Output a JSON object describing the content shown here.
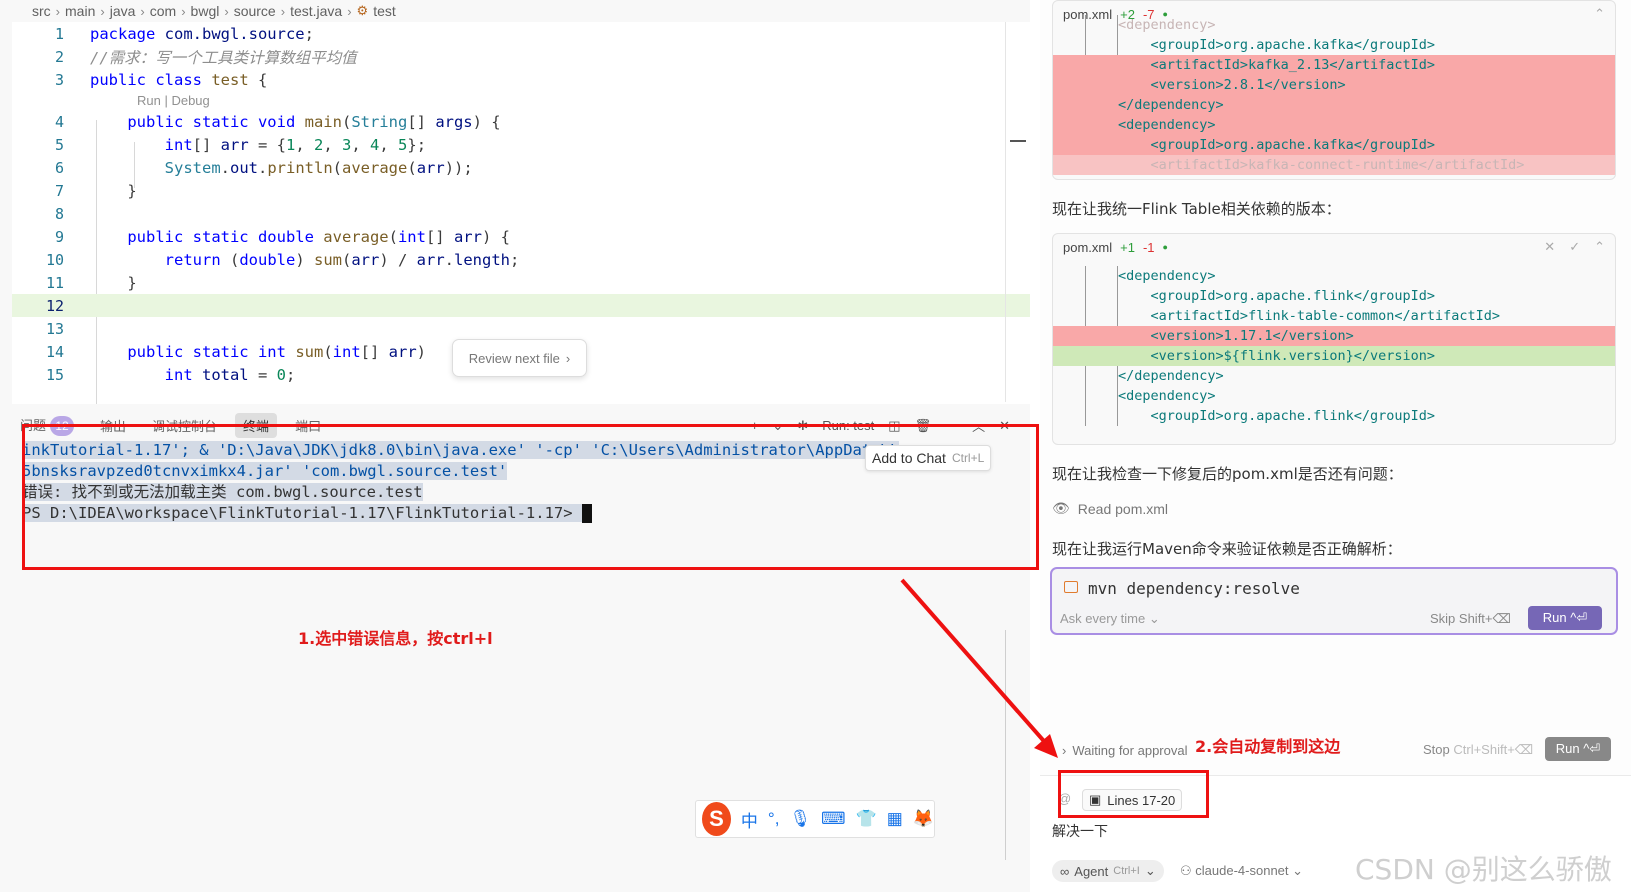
{
  "breadcrumb": {
    "items": [
      "src",
      "main",
      "java",
      "com",
      "bwgl",
      "source",
      "test.java",
      "test"
    ]
  },
  "editor": {
    "codelens": "Run | Debug",
    "lines": [
      {
        "n": "1",
        "code": "package com.bwgl.source;"
      },
      {
        "n": "2",
        "code": "//需求：写一个工具类计算数组平均值"
      },
      {
        "n": "3",
        "code": "public class test {"
      },
      {
        "n": "4",
        "code": "    public static void main(String[] args) {"
      },
      {
        "n": "5",
        "code": "        int[] arr = {1, 2, 3, 4, 5};"
      },
      {
        "n": "6",
        "code": "        System.out.println(average(arr));"
      },
      {
        "n": "7",
        "code": "    }"
      },
      {
        "n": "8",
        "code": ""
      },
      {
        "n": "9",
        "code": "    public static double average(int[] arr) {"
      },
      {
        "n": "10",
        "code": "        return (double) sum(arr) / arr.length;"
      },
      {
        "n": "11",
        "code": "    }"
      },
      {
        "n": "12",
        "code": ""
      },
      {
        "n": "13",
        "code": ""
      },
      {
        "n": "14",
        "code": "    public static int sum(int[] arr)"
      },
      {
        "n": "15",
        "code": "        int total = 0;"
      }
    ],
    "review_next_file": "Review next file"
  },
  "panel": {
    "tabs": [
      "问题",
      "输出",
      "调试控制台",
      "终端",
      "端口"
    ],
    "problems_count": "12",
    "run_label": "Run: test"
  },
  "terminal": {
    "lines": [
      "inkTutorial-1.17'; & 'D:\\Java\\JDK\\jdk8.0\\bin\\java.exe' '-cp' 'C:\\Users\\Administrator\\AppData\\L",
      "5bnsksravpzed0tcnvximkx4.jar' 'com.bwgl.source.test'",
      "错误: 找不到或无法加载主类 com.bwgl.source.test",
      "PS D:\\IDEA\\workspace\\FlinkTutorial-1.17\\FlinkTutorial-1.17> "
    ],
    "add_to_chat": "Add to Chat",
    "add_to_chat_shortcut": "Ctrl+L"
  },
  "annotations": {
    "step1": "1.选中错误信息，按ctrl+l",
    "step2": "2.会自动复制到这边"
  },
  "ime": {
    "items": [
      "中",
      "°,",
      "mic",
      "keyboard",
      "shirt",
      "apps",
      "fox"
    ]
  },
  "chat": {
    "diff1": {
      "file": "pom.xml",
      "plus": "+2",
      "minus": "-7",
      "lines": [
        {
          "kind": "fade",
          "text": "        <dependency>"
        },
        {
          "kind": "ctx",
          "text": "            <groupId>org.apache.kafka</groupId>"
        },
        {
          "kind": "del",
          "text": "            <artifactId>kafka_2.13</artifactId>"
        },
        {
          "kind": "del",
          "text": "            <version>2.8.1</version>"
        },
        {
          "kind": "del",
          "text": "        </dependency>"
        },
        {
          "kind": "del",
          "text": "        <dependency>"
        },
        {
          "kind": "del",
          "text": "            <groupId>org.apache.kafka</groupId>"
        },
        {
          "kind": "fade",
          "text": "            <artifactId>kafka-connect-runtime</artifactId>"
        }
      ]
    },
    "msg1": "现在让我统一Flink Table相关依赖的版本：",
    "diff2": {
      "file": "pom.xml",
      "plus": "+1",
      "minus": "-1",
      "lines": [
        {
          "kind": "ctx",
          "text": "        <dependency>"
        },
        {
          "kind": "ctx",
          "text": "            <groupId>org.apache.flink</groupId>"
        },
        {
          "kind": "ctx",
          "text": "            <artifactId>flink-table-common</artifactId>"
        },
        {
          "kind": "del",
          "text": "            <version>1.17.1</version>"
        },
        {
          "kind": "add",
          "text": "            <version>${flink.version}</version>"
        },
        {
          "kind": "ctx",
          "text": "        </dependency>"
        },
        {
          "kind": "ctx",
          "text": "        <dependency>"
        },
        {
          "kind": "ctx",
          "text": "            <groupId>org.apache.flink</groupId>"
        }
      ]
    },
    "msg2": "现在让我检查一下修复后的pom.xml是否还有问题：",
    "read_pom": "Read pom.xml",
    "msg3": "现在让我运行Maven命令来验证依赖是否正确解析：",
    "command": "mvn dependency:resolve",
    "ask_every_time": "Ask every time",
    "skip": "Skip Shift+⌫",
    "run": "Run ^⏎",
    "waiting": "Waiting for approval",
    "stop": "Stop",
    "stop_shortcut": "Ctrl+Shift+⌫",
    "run2": "Run ^⏎",
    "lines_chip": "Lines 17-20",
    "prompt": "解决一下",
    "agent": "Agent",
    "agent_shortcut": "Ctrl+I",
    "model": "claude-4-sonnet"
  },
  "watermark": "CSDN @别这么骄傲",
  "colors": {
    "annotation_red": "#ee1111",
    "run_button": "#7667b6",
    "added_line": "#e9f6df",
    "deleted_line": "#f9a8a8"
  }
}
